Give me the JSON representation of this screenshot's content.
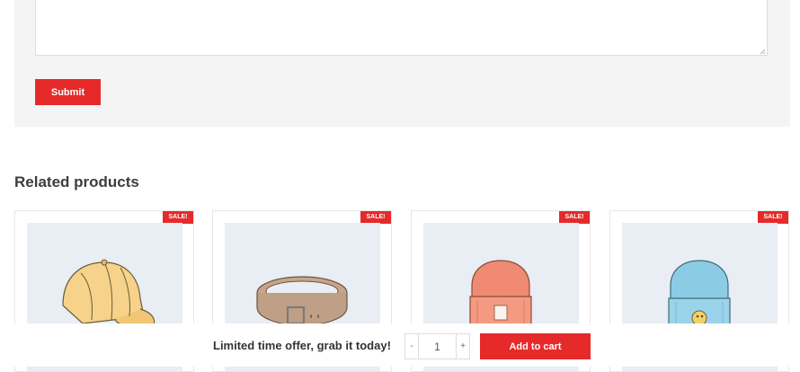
{
  "review_form": {
    "comment_value": "",
    "submit_label": "Submit"
  },
  "related": {
    "title": "Related products",
    "products": [
      {
        "badge": "SALE!",
        "image": "cap-illustration"
      },
      {
        "badge": "SALE!",
        "image": "belt-illustration"
      },
      {
        "badge": "SALE!",
        "image": "beanie-orange-illustration"
      },
      {
        "badge": "SALE!",
        "image": "beanie-blue-illustration"
      }
    ]
  },
  "sticky_cart": {
    "offer_text": "Limited time offer, grab it today!",
    "minus_label": "-",
    "quantity": "1",
    "plus_label": "+",
    "add_to_cart_label": "Add to cart"
  },
  "colors": {
    "accent": "#e62a2a",
    "panel_bg": "#f4f4f4",
    "image_bg": "#e8eef3"
  }
}
